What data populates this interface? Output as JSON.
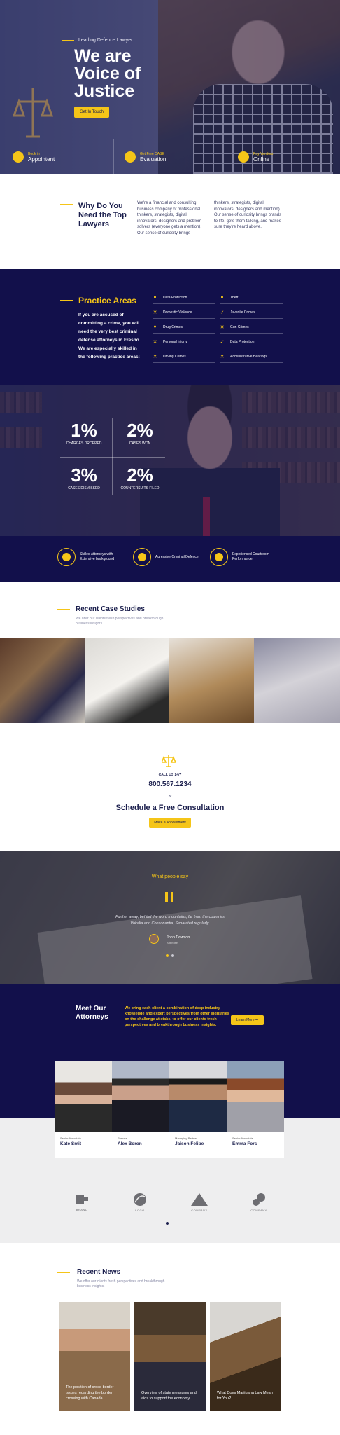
{
  "hero": {
    "subtitle": "Leading Defence Lawyer",
    "title": "We are Voice of Justice",
    "button": "Get In Touch",
    "bar": [
      {
        "t1": "Book in",
        "t2": "Appointent",
        "icon": "user-pin-icon"
      },
      {
        "t1": "Get Free CASE",
        "t2": "Evaluation",
        "icon": "handshake-icon"
      },
      {
        "t1": "Pay Vendors",
        "t2": "Online",
        "icon": "scales-icon"
      }
    ]
  },
  "why": {
    "title": "Why Do You Need the Top Lawyers",
    "col1": "We're a financial and consulting business company of professional thinkers, strategists, digital innovators, designers and problem solvers (everyone gets a mention). Our sense of curiosity brings",
    "col2": "thinkers, strategists, digital innovators, designers and mention). Our sense of curiosity brings brands to life, gets them talking, and makes sure they're heard above."
  },
  "practice": {
    "title": "Practice Areas",
    "description": "If you are accused of committing a crime, you will need the very best criminal defense attorneys in Fresno. We are especially skilled in the following practice areas:",
    "col1": [
      "Data Protection",
      "Domestic Violence",
      "Drug Crimes",
      "Personal Injurty",
      "Driving Crimes"
    ],
    "col2": [
      "Theft",
      "Juvenile Crimes",
      "Gun Crimes",
      "Data Protection",
      "Administrative Hearings"
    ]
  },
  "stats": [
    {
      "value": "1%",
      "label": "CHARGES DROPPED"
    },
    {
      "value": "2%",
      "label": "CASES WON"
    },
    {
      "value": "3%",
      "label": "CASES DISMISSED"
    },
    {
      "value": "2%",
      "label": "COUNTERSUITS FILED"
    }
  ],
  "features": [
    "Skilled Attorneys with Extensive background",
    "Agressive Criminal Defence",
    "Experienced Courtroom Performance"
  ],
  "cases": {
    "title": "Recent Case Studies",
    "subtitle": "We offer our clients fresh perspectives and breakthrough business insights."
  },
  "cta": {
    "call": "CALL US 24/7",
    "phone": "800.567.1234",
    "or": "or",
    "title": "Schedule a Free Consultation",
    "button": "Make a Appointment"
  },
  "testimonial": {
    "title": "What people say",
    "text": "Further away, behind the word mountains, far from the countries Vokalia and Consonantia, Separated regularly.",
    "name": "John Dowson",
    "role": "Attendee"
  },
  "attorneys": {
    "title": "Meet Our Attorneys",
    "text": "We bring each client a combination of deep industry knowledge and expert perspectives from other industries on the challenge at stake, to offer our clients fresh perspectives and breakthrough business insights.",
    "button": "Learn More",
    "people": [
      {
        "role": "Senior Associate",
        "name": "Kate Smit"
      },
      {
        "role": "Partner",
        "name": "Alex Boron"
      },
      {
        "role": "Managing Partner",
        "name": "Jaison Felipe"
      },
      {
        "role": "Senior Associate",
        "name": "Emma Fors"
      }
    ]
  },
  "logos": [
    "BRAND",
    "LOGO",
    "COMPANY",
    "COMPANY"
  ],
  "news": {
    "title": "Recent News",
    "subtitle": "We offer our clients fresh perspectives and breakthrough business insights.",
    "items": [
      "The position of cross-border issues regarding the border crossing with Canada",
      "Overview of state measures and aids to support the economy",
      "What Does Marijuana Law Mean for You?"
    ]
  },
  "colors": {
    "accent": "#f5c518",
    "navy": "#12104b"
  }
}
